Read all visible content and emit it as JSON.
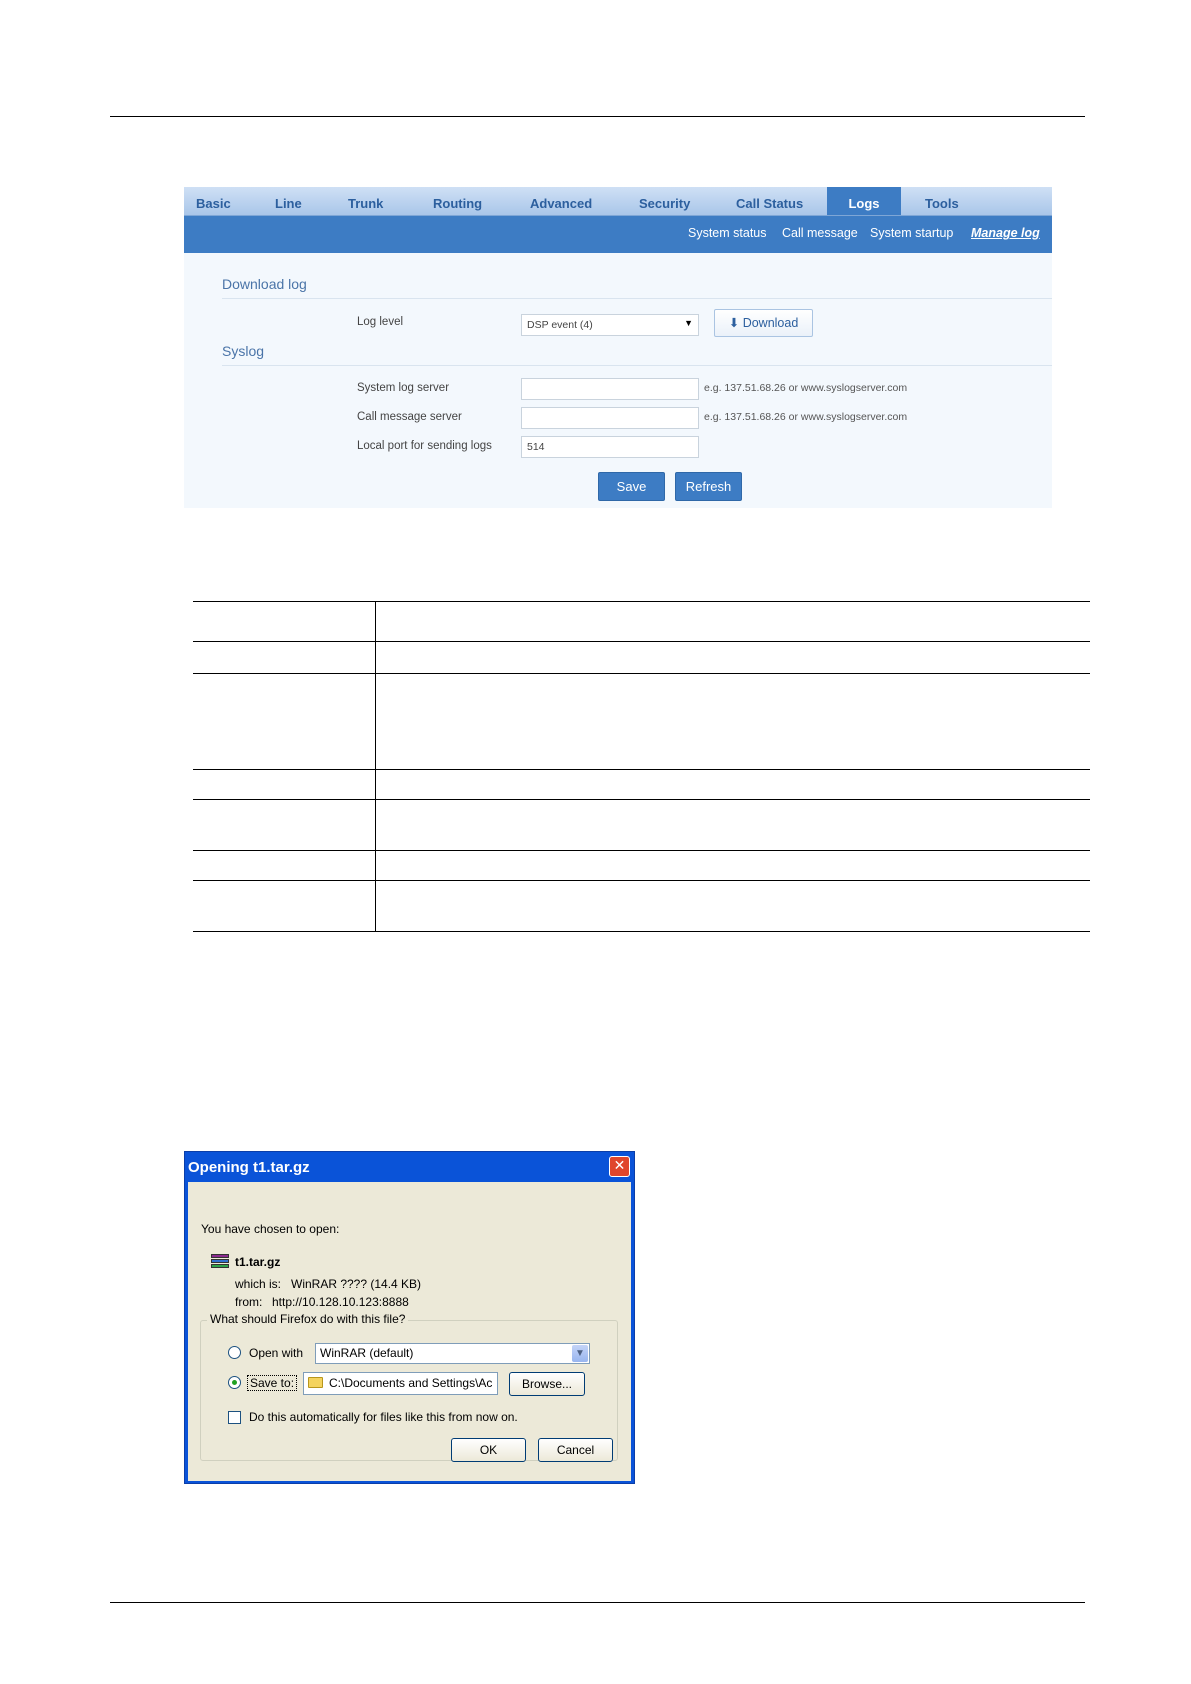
{
  "web_ui": {
    "tabs": [
      "Basic",
      "Line",
      "Trunk",
      "Routing",
      "Advanced",
      "Security",
      "Call Status",
      "Logs",
      "Tools"
    ],
    "active_tab": "Logs",
    "subtabs": [
      "System status",
      "Call message",
      "System startup",
      "Manage log"
    ],
    "active_subtab": "Manage log",
    "download_section": {
      "title": "Download log",
      "log_level_label": "Log level",
      "log_level_value": "DSP event (4)",
      "download_button": "Download"
    },
    "syslog_section": {
      "title": "Syslog",
      "system_log_server_label": "System log server",
      "system_log_server_value": "",
      "system_log_server_hint": "e.g. 137.51.68.26 or www.syslogserver.com",
      "call_message_server_label": "Call message server",
      "call_message_server_value": "",
      "call_message_server_hint": "e.g. 137.51.68.26 or www.syslogserver.com",
      "local_port_label": "Local port for sending logs",
      "local_port_value": "514"
    },
    "save_button": "Save",
    "refresh_button": "Refresh"
  },
  "dialog": {
    "title": "Opening t1.tar.gz",
    "close_glyph": "✕",
    "intro": "You have chosen to open:",
    "filename": "t1.tar.gz",
    "which_is_label": "which is:",
    "which_is_value": "WinRAR ???? (14.4 KB)",
    "from_label": "from:",
    "from_value": "http://10.128.10.123:8888",
    "question": "What should Firefox do with this file?",
    "open_with_label": "Open with",
    "open_with_value": "WinRAR (default)",
    "save_to_label": "Save to:",
    "save_to_value": "C:\\Documents and Settings\\Ac",
    "browse_button": "Browse...",
    "auto_checkbox_label": "Do this automatically for files like this from now on.",
    "ok_button": "OK",
    "cancel_button": "Cancel",
    "selected_option": "save_to"
  }
}
